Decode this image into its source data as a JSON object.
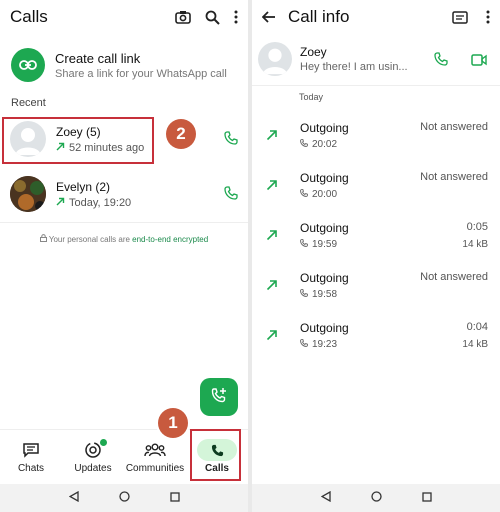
{
  "left": {
    "title": "Calls",
    "create_link": {
      "title": "Create call link",
      "subtitle": "Share a link for your WhatsApp call"
    },
    "recent_label": "Recent",
    "calls": [
      {
        "name": "Zoey (5)",
        "meta": "52 minutes ago"
      },
      {
        "name": "Evelyn (2)",
        "meta": "Today, 19:20"
      }
    ],
    "encryption_prefix": "Your personal calls are ",
    "encryption_link": "end-to-end encrypted",
    "nav": [
      {
        "label": "Chats"
      },
      {
        "label": "Updates"
      },
      {
        "label": "Communities"
      },
      {
        "label": "Calls"
      }
    ]
  },
  "right": {
    "title": "Call info",
    "contact": {
      "name": "Zoey",
      "status": "Hey there! I am usin..."
    },
    "day_label": "Today",
    "logs": [
      {
        "direction": "Outgoing",
        "time": "20:02",
        "status": "Not answered",
        "size": ""
      },
      {
        "direction": "Outgoing",
        "time": "20:00",
        "status": "Not answered",
        "size": ""
      },
      {
        "direction": "Outgoing",
        "time": "19:59",
        "status": "0:05",
        "size": "14 kB"
      },
      {
        "direction": "Outgoing",
        "time": "19:58",
        "status": "Not answered",
        "size": ""
      },
      {
        "direction": "Outgoing",
        "time": "19:23",
        "status": "0:04",
        "size": "14 kB"
      }
    ]
  },
  "markers": [
    "1",
    "2"
  ],
  "colors": {
    "accent": "#1da851",
    "marker": "#c85a3e",
    "highlight": "#c7303a"
  }
}
